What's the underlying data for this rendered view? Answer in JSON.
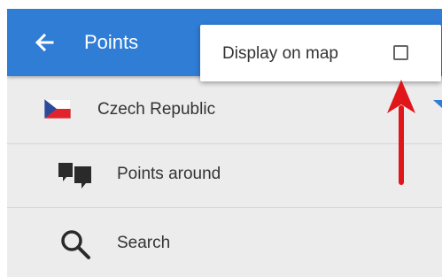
{
  "appbar": {
    "back_icon": "arrow-left-icon",
    "title": "Points"
  },
  "popup_menu": {
    "display_on_map_label": "Display on map",
    "display_on_map_checked": false
  },
  "list": {
    "country": {
      "label": "Czech Republic",
      "icon": "czech-flag-icon"
    },
    "points_around": {
      "label": "Points around",
      "icon": "points-around-icon"
    },
    "search": {
      "label": "Search",
      "icon": "search-icon"
    }
  },
  "colors": {
    "appbar": "#2f7dd4",
    "annotation_arrow": "#e0161b",
    "flag_blue": "#2a4b9b",
    "flag_red": "#e2232b"
  }
}
